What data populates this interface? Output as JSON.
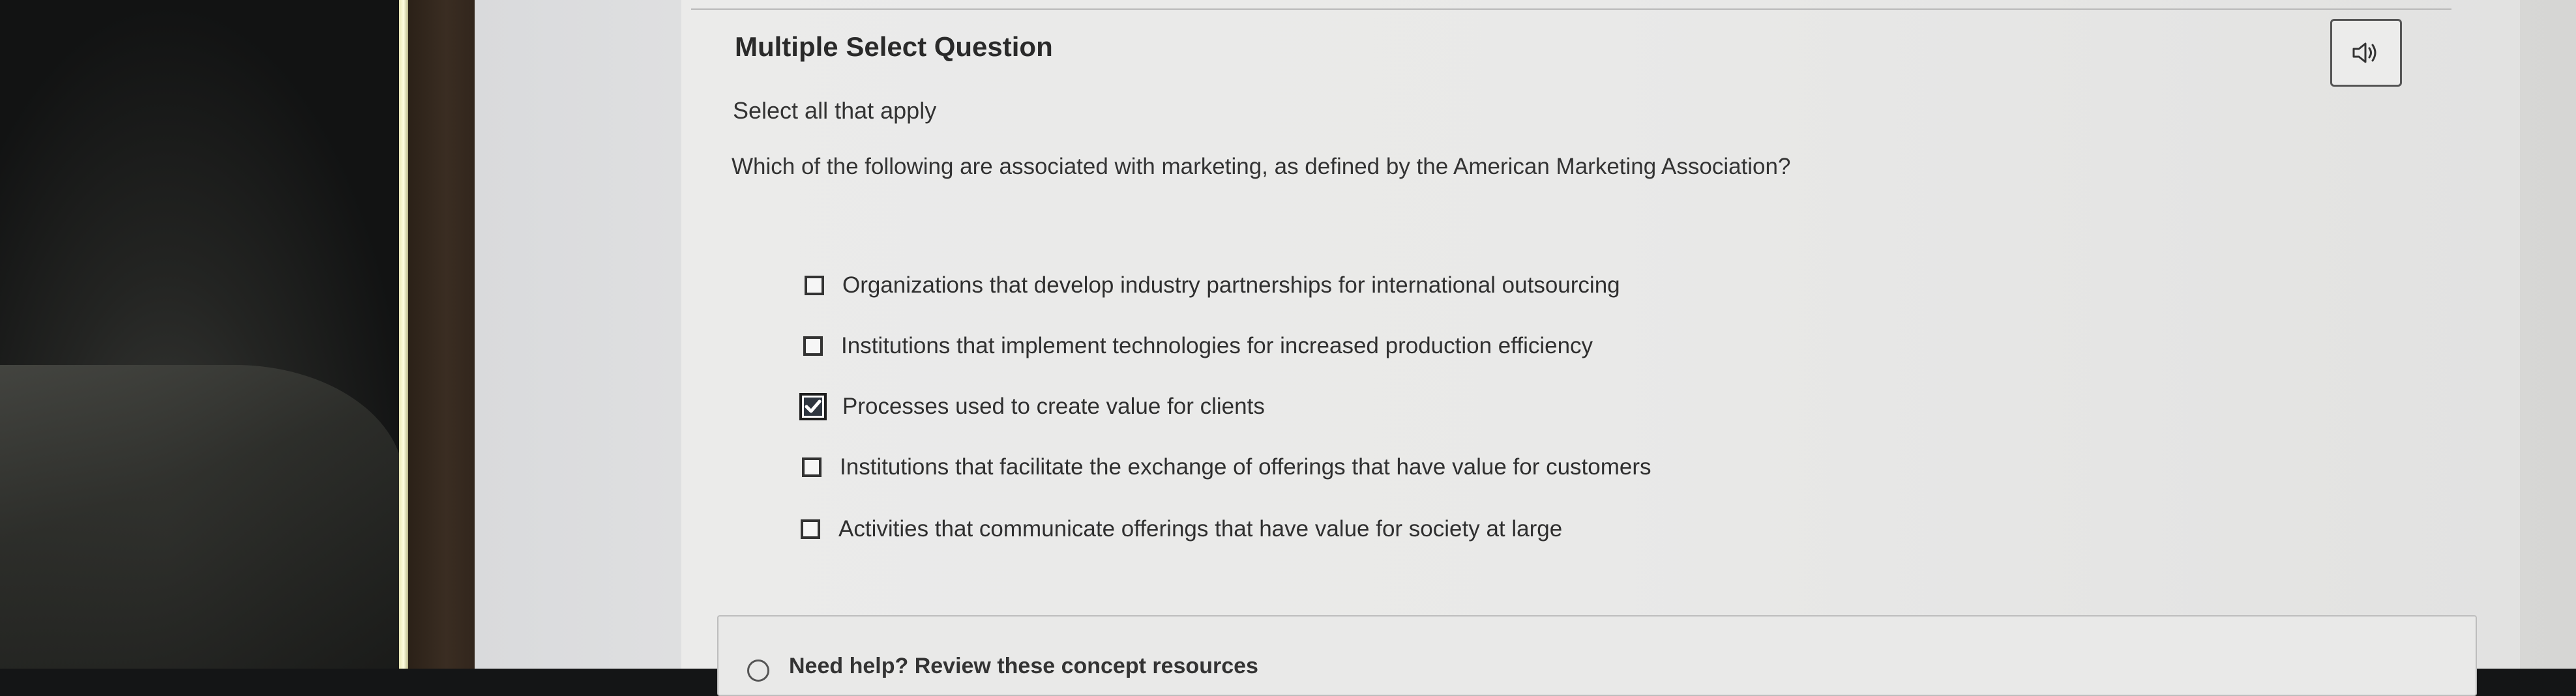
{
  "question": {
    "type_label": "Multiple Select Question",
    "instruction": "Select all that apply",
    "prompt": "Which of the following are associated with marketing, as defined by the American Marketing Association?"
  },
  "audio_button": {
    "icon": "speaker-icon"
  },
  "options": [
    {
      "label": "Organizations that develop industry partnerships for international outsourcing",
      "checked": false
    },
    {
      "label": "Institutions that implement technologies for increased production efficiency",
      "checked": false
    },
    {
      "label": "Processes used to create value for clients",
      "checked": true
    },
    {
      "label": "Institutions that facilitate the exchange of offerings that have value for customers",
      "checked": false
    },
    {
      "label": "Activities that communicate offerings that have value for society at large",
      "checked": false
    }
  ],
  "next_section": {
    "label": "Need help? Review these concept resources"
  }
}
